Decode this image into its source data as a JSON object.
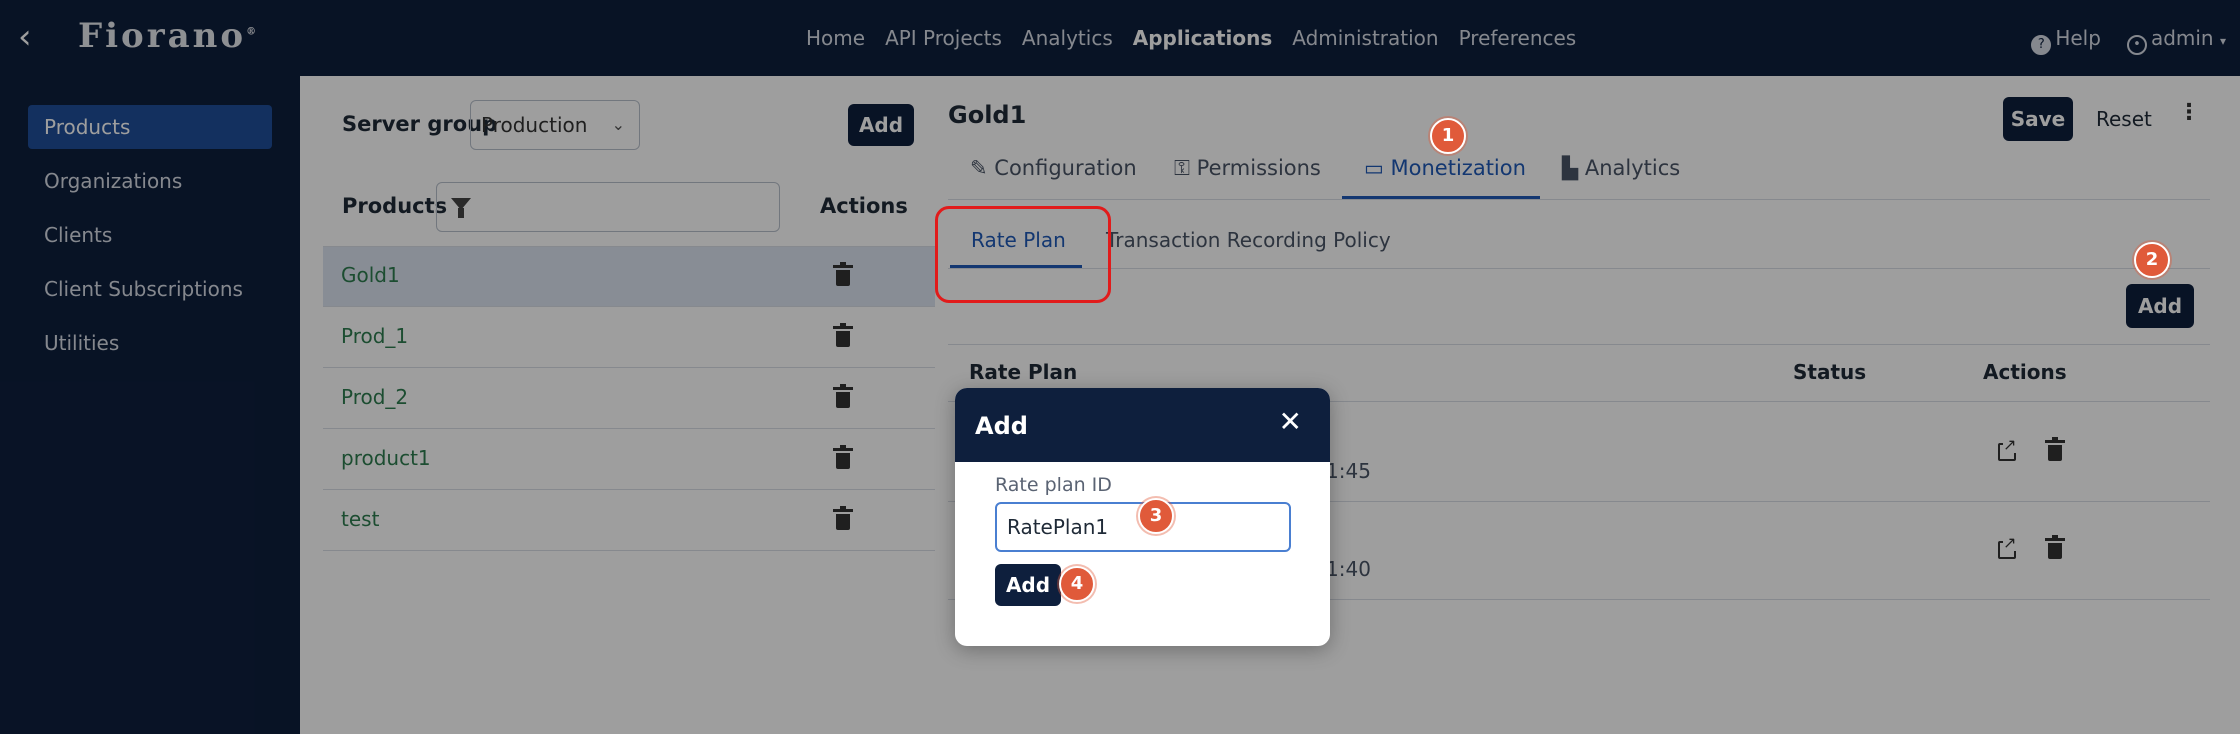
{
  "app": {
    "back_icon": "chevron-left-icon",
    "logo": "Fiorano",
    "logo_mark": "®"
  },
  "nav": {
    "items": [
      "Home",
      "API Projects",
      "Analytics",
      "Applications",
      "Administration",
      "Preferences"
    ],
    "active": "Applications",
    "help": "Help",
    "user": "admin"
  },
  "sidebar": {
    "items": [
      "Products",
      "Organizations",
      "Clients",
      "Client Subscriptions",
      "Utilities"
    ],
    "active": "Products"
  },
  "products_panel": {
    "server_group_label": "Server group",
    "server_group_value": "Production",
    "add_label": "Add",
    "products_header": "Products",
    "actions_header": "Actions",
    "items": [
      "Gold1",
      "Prod_1",
      "Prod_2",
      "product1",
      "test"
    ],
    "selected": "Gold1"
  },
  "detail": {
    "title": "Gold1",
    "save_label": "Save",
    "reset_label": "Reset",
    "tabs": [
      "Configuration",
      "Permissions",
      "Monetization",
      "Analytics"
    ],
    "active_tab": "Monetization",
    "subtabs": [
      "Rate Plan",
      "Transaction Recording Policy"
    ],
    "active_subtab": "Rate Plan",
    "add_label": "Add",
    "table": {
      "headers": [
        "Rate Plan",
        "Status",
        "Actions"
      ],
      "rows": [
        {
          "partial_text": "1:45"
        },
        {
          "partial_text": "1:40"
        }
      ]
    }
  },
  "modal": {
    "title": "Add",
    "field_label": "Rate plan ID",
    "field_value": "RatePlan1",
    "submit_label": "Add"
  },
  "annotations": {
    "badges": [
      "1",
      "2",
      "3",
      "4"
    ],
    "highlight_color": "#e11b1b",
    "badge_color": "#e05a3a"
  },
  "colors": {
    "navy": "#0e1f3d",
    "accent_blue": "#1f5ab7",
    "sidebar_active": "#1f4e9a",
    "product_green": "#2e7d4f"
  }
}
